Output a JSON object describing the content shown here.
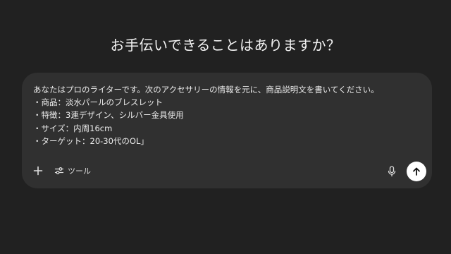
{
  "heading": "お手伝いできることはありますか？",
  "composer": {
    "prompt_lines": [
      "あなたはプロのライターです。次のアクセサリーの情報を元に、商品説明文を書いてください。",
      "・商品：淡水パールのブレスレット",
      "・特徴：3連デザイン、シルバー金具使用",
      "・サイズ：内周16cm",
      "・ターゲット：20-30代のOL」"
    ],
    "tools_label": "ツール"
  },
  "icons": {
    "add": "plus-icon",
    "tools": "sliders-icon",
    "mic": "microphone-icon",
    "send": "arrow-up-icon"
  },
  "colors": {
    "background": "#212121",
    "composer": "#303030",
    "send_button": "#ffffff"
  }
}
